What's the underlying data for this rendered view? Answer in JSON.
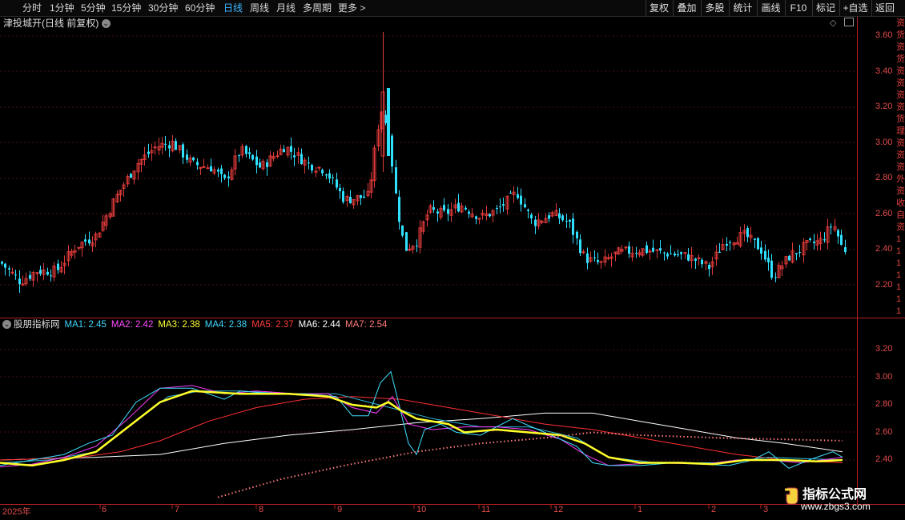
{
  "toolbar": {
    "periods": [
      "分时",
      "1分钟",
      "5分钟",
      "15分钟",
      "30分钟",
      "60分钟",
      "日线",
      "周线",
      "月线",
      "多周期",
      "更多 >"
    ],
    "active_period": "日线",
    "right_buttons": [
      "复权",
      "叠加",
      "多股",
      "统计",
      "画线",
      "F10",
      "标记",
      "+自选",
      "返回"
    ]
  },
  "main_chart": {
    "title": "津投城开(日线 前复权)",
    "y_ticks": [
      "3.60",
      "3.40",
      "3.20",
      "3.00",
      "2.80",
      "2.60",
      "2.40",
      "2.20"
    ]
  },
  "indicator": {
    "name": "股朋指标网",
    "ma_labels": [
      {
        "text": "MA1: 2.45",
        "color": "#3fd7ff"
      },
      {
        "text": "MA2: 2.42",
        "color": "#ff4dff"
      },
      {
        "text": "MA3: 2.38",
        "color": "#ffff33"
      },
      {
        "text": "MA4: 2.38",
        "color": "#3fd7ff"
      },
      {
        "text": "MA5: 2.37",
        "color": "#ff3b3b"
      },
      {
        "text": "MA6: 2.44",
        "color": "#ffffff"
      },
      {
        "text": "MA7: 2.54",
        "color": "#ff7a7a"
      }
    ],
    "y_ticks": [
      "3.20",
      "3.00",
      "2.80",
      "2.60",
      "2.40"
    ]
  },
  "x_axis": {
    "labels": [
      "2025年",
      "6",
      "7",
      "8",
      "9",
      "10",
      "11",
      "12",
      "1",
      "2",
      "3"
    ]
  },
  "side_strip_glyphs": [
    "资",
    "货",
    "资",
    "货",
    "资",
    "资",
    "资",
    "资",
    "货",
    "理",
    "资",
    "资",
    "资",
    "外",
    "资",
    "收",
    "自",
    "资",
    "1",
    "1",
    "1",
    "1",
    "1",
    "1",
    "1"
  ],
  "watermark": {
    "name": "指标公式网",
    "url": "www.zbgs3.com"
  },
  "colors": {
    "up": "#e03a3a",
    "down": "#2fe0ff",
    "active": "#3fb7ff",
    "axis": "#e14b4b",
    "background": "#000000"
  }
}
